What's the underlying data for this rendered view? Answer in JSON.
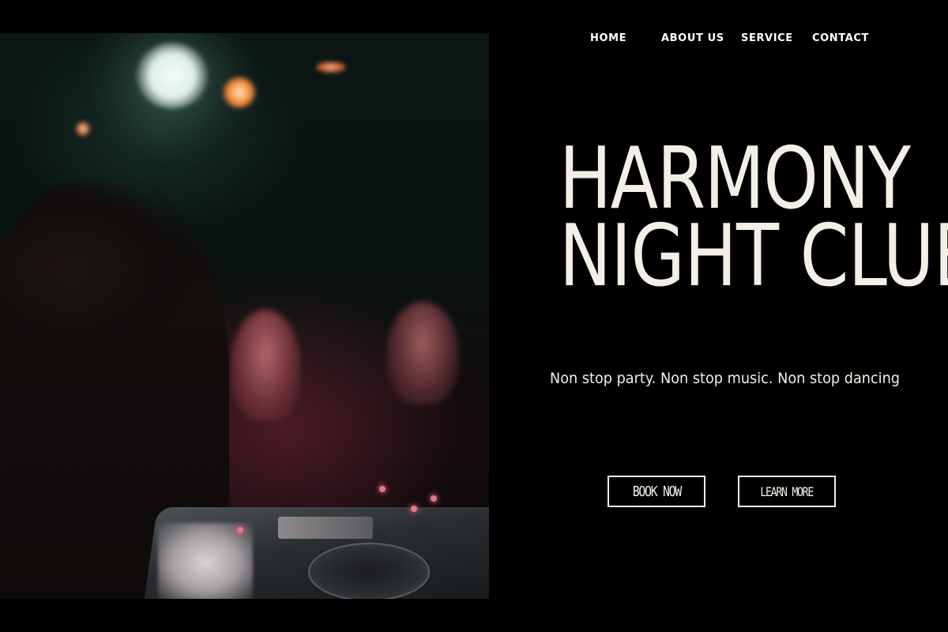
{
  "nav": {
    "items": [
      {
        "label": "HOME"
      },
      {
        "label": "ABOUT US"
      },
      {
        "label": "SERVICE"
      },
      {
        "label": "CONTACT"
      }
    ]
  },
  "hero": {
    "title_line_1": "HARMONY",
    "title_line_2": "NIGHT CLUB",
    "tagline": "Non stop party. Non stop music. Non stop dancing",
    "image_alt": "DJ performing in front of a dancing crowd in a dark club"
  },
  "cta": {
    "book_label": "BOOK NOW",
    "learn_label": "LEARN MORE"
  },
  "colors": {
    "background": "#000000",
    "text": "#f4efe6",
    "nav_text": "#ffffff"
  }
}
